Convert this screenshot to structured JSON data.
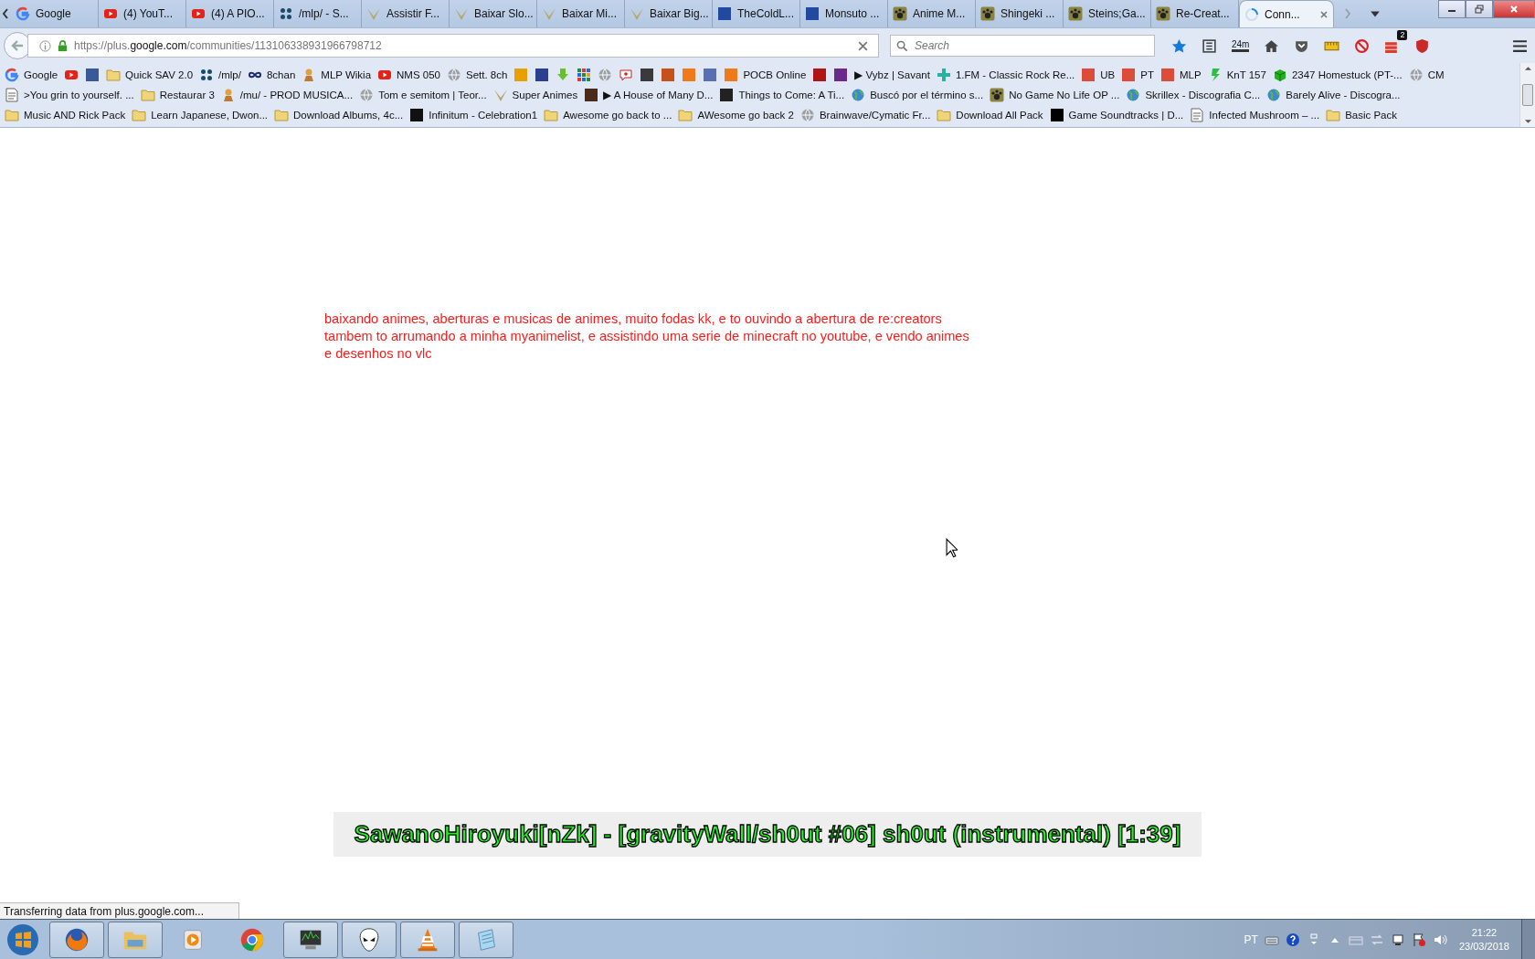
{
  "tabs": [
    {
      "label": "Google",
      "kind": "google",
      "selected": false
    },
    {
      "label": "(4) YouT...",
      "kind": "youtube",
      "selected": false
    },
    {
      "label": "(4) A PIO...",
      "kind": "youtube",
      "selected": false
    },
    {
      "label": "/mlp/ - S...",
      "kind": "dots",
      "selected": false
    },
    {
      "label": "Assistir F...",
      "kind": "v",
      "selected": false
    },
    {
      "label": "Baixar Slo...",
      "kind": "v",
      "selected": false
    },
    {
      "label": "Baixar Mi...",
      "kind": "v",
      "selected": false
    },
    {
      "label": "Baixar Big...",
      "kind": "v",
      "selected": false
    },
    {
      "label": "TheColdL...",
      "kind": "square",
      "color": "#1f4aa0",
      "selected": false
    },
    {
      "label": "Monsuto ...",
      "kind": "square",
      "color": "#1f4aa0",
      "selected": false
    },
    {
      "label": "Anime M...",
      "kind": "paw",
      "selected": false
    },
    {
      "label": "Shingeki ...",
      "kind": "paw",
      "selected": false
    },
    {
      "label": "Steins;Ga...",
      "kind": "paw",
      "selected": false
    },
    {
      "label": "Re-Creat...",
      "kind": "paw",
      "selected": false
    },
    {
      "label": "Conn...",
      "kind": "spinner",
      "selected": true
    }
  ],
  "address_bar": {
    "url": "https://plus.**google.com**/communities/113106338931966798712"
  },
  "search": {
    "placeholder": "Search"
  },
  "toolbar": {
    "timer_label": "24m",
    "badge": "2"
  },
  "bookmark_rows": [
    [
      {
        "label": "Google",
        "kind": "google"
      },
      {
        "kind": "youtube"
      },
      {
        "kind": "square",
        "color": "#3b5998"
      },
      {
        "label": "Quick SAV 2.0",
        "kind": "folder"
      },
      {
        "label": "/mlp/",
        "kind": "dots"
      },
      {
        "label": "8chan",
        "kind": "infinity"
      },
      {
        "label": "MLP Wikia",
        "kind": "figure"
      },
      {
        "label": "NMS 050",
        "kind": "youtube"
      },
      {
        "label": "Sett. 8ch",
        "kind": "globe"
      },
      {
        "kind": "square",
        "color": "#e8a000"
      },
      {
        "kind": "square",
        "color": "#2a3f8f"
      },
      {
        "kind": "download"
      },
      {
        "kind": "grid"
      },
      {
        "kind": "globe"
      },
      {
        "kind": "chat"
      },
      {
        "kind": "square",
        "color": "#3a3a3a"
      },
      {
        "kind": "square",
        "color": "#c8501a"
      },
      {
        "kind": "square",
        "color": "#f07a1a"
      },
      {
        "kind": "square",
        "color": "#5a6fb0"
      },
      {
        "label": "POCB Online",
        "kind": "square",
        "color": "#f07a1a"
      },
      {
        "kind": "square",
        "color": "#b01515"
      },
      {
        "kind": "square",
        "color": "#6a2a8a"
      },
      {
        "label": "▶ Vybz | Savant",
        "kind": "text"
      },
      {
        "label": "1.FM - Classic Rock Re...",
        "kind": "cross"
      },
      {
        "label": "UB",
        "kind": "square",
        "color": "#dd4b39"
      },
      {
        "label": "PT",
        "kind": "square",
        "color": "#dd4b39"
      },
      {
        "label": "MLP",
        "kind": "square",
        "color": "#dd4b39"
      },
      {
        "label": "KnT 157",
        "kind": "zigzag"
      },
      {
        "label": "2347 Homestuck (PT-...",
        "kind": "cube"
      },
      {
        "label": "CM",
        "kind": "globe"
      }
    ],
    [
      {
        "label": ">You grin to yourself. ...",
        "kind": "document"
      },
      {
        "label": "Restaurar 3",
        "kind": "folder"
      },
      {
        "label": "/mu/ - PROD MUSICA...",
        "kind": "figure"
      },
      {
        "label": "Tom e semitom | Teor...",
        "kind": "globe"
      },
      {
        "label": "Super Animes",
        "kind": "v"
      },
      {
        "label": "▶ A House of Many D...",
        "kind": "square",
        "color": "#4a2a1a"
      },
      {
        "label": "Things to Come: A Ti...",
        "kind": "square",
        "color": "#222222"
      },
      {
        "label": "Buscó por el término s...",
        "kind": "earth"
      },
      {
        "label": "No Game No Life OP ...",
        "kind": "paw"
      },
      {
        "label": "Skrillex - Discografia C...",
        "kind": "earth"
      },
      {
        "label": "Barely Alive - Discogra...",
        "kind": "earth"
      }
    ],
    [
      {
        "label": "Music AND Rick Pack",
        "kind": "folder"
      },
      {
        "label": "Learn Japanese, Dwon...",
        "kind": "folder"
      },
      {
        "label": "Download Albums, 4c...",
        "kind": "folder"
      },
      {
        "label": "Infinitum - Celebration1",
        "kind": "square",
        "color": "#111111"
      },
      {
        "label": "Awesome go back to ...",
        "kind": "folder"
      },
      {
        "label": "AWesome go back 2",
        "kind": "folder"
      },
      {
        "label": "Brainwave/Cymatic Fr...",
        "kind": "globe"
      },
      {
        "label": "Download All Pack",
        "kind": "folder"
      },
      {
        "label": "Game Soundtracks | D...",
        "kind": "square",
        "color": "#000000"
      },
      {
        "label": "Infected Mushroom – ...",
        "kind": "document"
      },
      {
        "label": "Basic Pack",
        "kind": "folder"
      }
    ]
  ],
  "page": {
    "message": "baixando animes, aberturas e musicas de animes, muito fodas kk, e to ouvindo a abertura de re:creators tambem to arrumando a minha myanimelist, e assistindo uma serie de minecraft no youtube, e vendo animes e desenhos no vlc",
    "now_playing": "SawanoHiroyuki[nZk] - [gravityWall/sh0ut #06] sh0ut (instrumental) [1:39]"
  },
  "status_bar": "Transferring data from plus.google.com...",
  "taskbar": {
    "apps": [
      {
        "kind": "browser",
        "running": true
      },
      {
        "kind": "folders",
        "running": true
      },
      {
        "kind": "player",
        "running": false
      },
      {
        "kind": "chrome",
        "running": false
      },
      {
        "kind": "monitor",
        "running": true
      },
      {
        "kind": "alien",
        "running": true
      },
      {
        "kind": "cone",
        "running": true
      },
      {
        "kind": "notepad",
        "running": true
      }
    ],
    "language": "PT",
    "time": "21:22",
    "date": "23/03/2018"
  }
}
